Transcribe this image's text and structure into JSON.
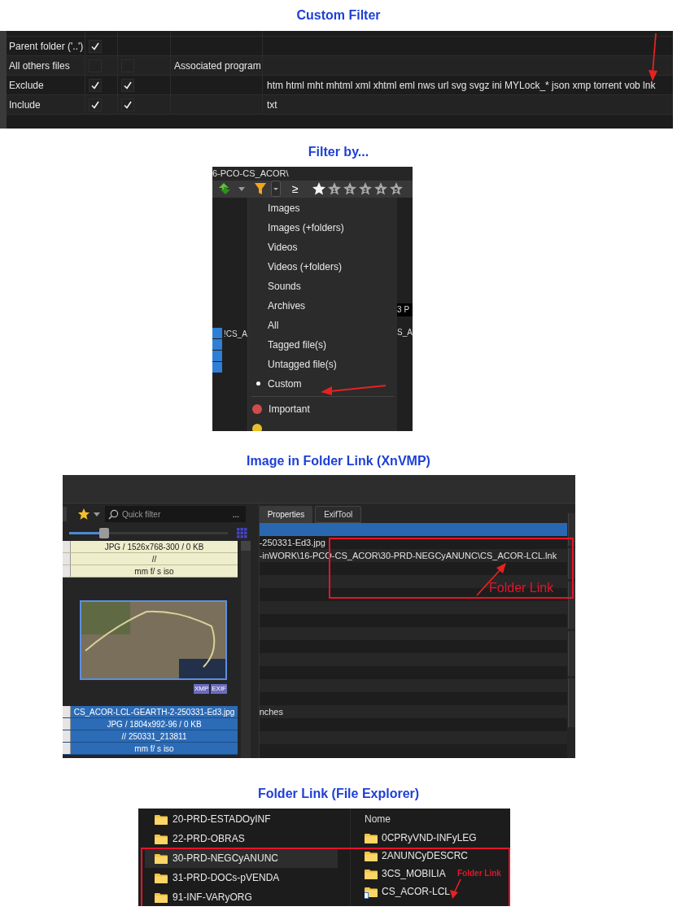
{
  "custom_filter": {
    "heading": "Custom Filter",
    "rows": [
      {
        "label": "Parent folder ('..')",
        "checks": [
          {
            "checked": true
          }
        ]
      },
      {
        "label": "All others files",
        "checks": [
          {
            "checked": false
          },
          {
            "checked": false
          }
        ],
        "program": "Associated program"
      },
      {
        "label": "Exclude",
        "checks": [
          {
            "checked": true
          },
          {
            "checked": true
          }
        ],
        "extensions": "htm html mht mhtml xml xhtml eml nws url svg svgz ini MYLock_* json xmp torrent vob lnk"
      },
      {
        "label": "Include",
        "checks": [
          {
            "checked": true
          },
          {
            "checked": true
          }
        ],
        "extensions": "txt"
      }
    ]
  },
  "filter_menu": {
    "heading": "Filter by...",
    "path": "6-PCO-CS_ACOR\\",
    "rating_operator": "≥",
    "stars": 1,
    "star_numbers": [
      "1",
      "2",
      "3",
      "4",
      "5"
    ],
    "background_fragments": [
      "!CS_A",
      "3 P",
      "S_A"
    ],
    "items": [
      {
        "label": "Images",
        "selected": false
      },
      {
        "label": "Images (+folders)",
        "selected": false
      },
      {
        "label": "Videos",
        "selected": false
      },
      {
        "label": "Videos (+folders)",
        "selected": false
      },
      {
        "label": "Sounds",
        "selected": false
      },
      {
        "label": "Archives",
        "selected": false
      },
      {
        "label": "All",
        "selected": false
      },
      {
        "label": "Tagged file(s)",
        "selected": false
      },
      {
        "label": "Untagged file(s)",
        "selected": false
      },
      {
        "label": "Custom",
        "selected": true
      }
    ],
    "tags": [
      {
        "label": "Important",
        "color": "#d24b4b"
      },
      {
        "color": "#e6c02a"
      }
    ]
  },
  "viewer": {
    "heading": "Image in Folder Link (XnVMP)",
    "quick_filter": {
      "placeholder": "Quick filter"
    },
    "more": "...",
    "slider": {
      "level": 0.22
    },
    "top_info": [
      "JPG / 1526x768-300 / 0 KB",
      "//",
      "mm f/ s iso"
    ],
    "badges": [
      "XMP",
      "EXIF"
    ],
    "selected_info": [
      "CS_ACOR-LCL-GEARTH-2-250331-Ed3.jpg",
      "JPG / 1804x992-96 / 0 KB",
      "// 250331_213811",
      "mm f/ s iso"
    ],
    "tabs": [
      {
        "label": "Properties",
        "selected": true
      },
      {
        "label": "ExifTool",
        "selected": false
      }
    ],
    "property_rows": [
      {
        "selected": true
      },
      {
        "text": "-250331-Ed3.jpg",
        "selected": false
      },
      {
        "text": "-inWORK\\16-PCO-CS_ACOR\\30-PRD-NEGCyANUNC\\CS_ACOR-LCL.lnk",
        "selected": false
      },
      {
        "selected": false
      },
      {
        "selected": false
      },
      {
        "selected": false
      },
      {
        "selected": false
      },
      {
        "selected": false
      },
      {
        "selected": false
      },
      {
        "selected": false
      },
      {
        "selected": false
      },
      {
        "selected": false
      },
      {
        "selected": false
      },
      {
        "selected": false
      },
      {
        "text": "nches",
        "selected": false
      },
      {
        "selected": false
      },
      {
        "selected": false
      }
    ],
    "annotation": "Folder Link"
  },
  "explorer": {
    "heading": "Folder Link (File Explorer)",
    "tree": [
      {
        "label": "20-PRD-ESTADOyINF",
        "selected": false
      },
      {
        "label": "22-PRD-OBRAS",
        "selected": false
      },
      {
        "label": "30-PRD-NEGCyANUNC",
        "selected": true
      },
      {
        "label": "31-PRD-DOCs-pVENDA",
        "selected": false
      },
      {
        "label": "91-INF-VARyORG",
        "selected": false
      }
    ],
    "column_header": "Nome",
    "items": [
      {
        "label": "0CPRyVND-INFyLEG",
        "kind": "folder"
      },
      {
        "label": "2ANUNCyDESCRC",
        "kind": "folder"
      },
      {
        "label": "3CS_MOBILIA",
        "kind": "folder"
      },
      {
        "label": "CS_ACOR-LCL",
        "kind": "shortcut"
      }
    ],
    "annotation": "Folder Link"
  }
}
